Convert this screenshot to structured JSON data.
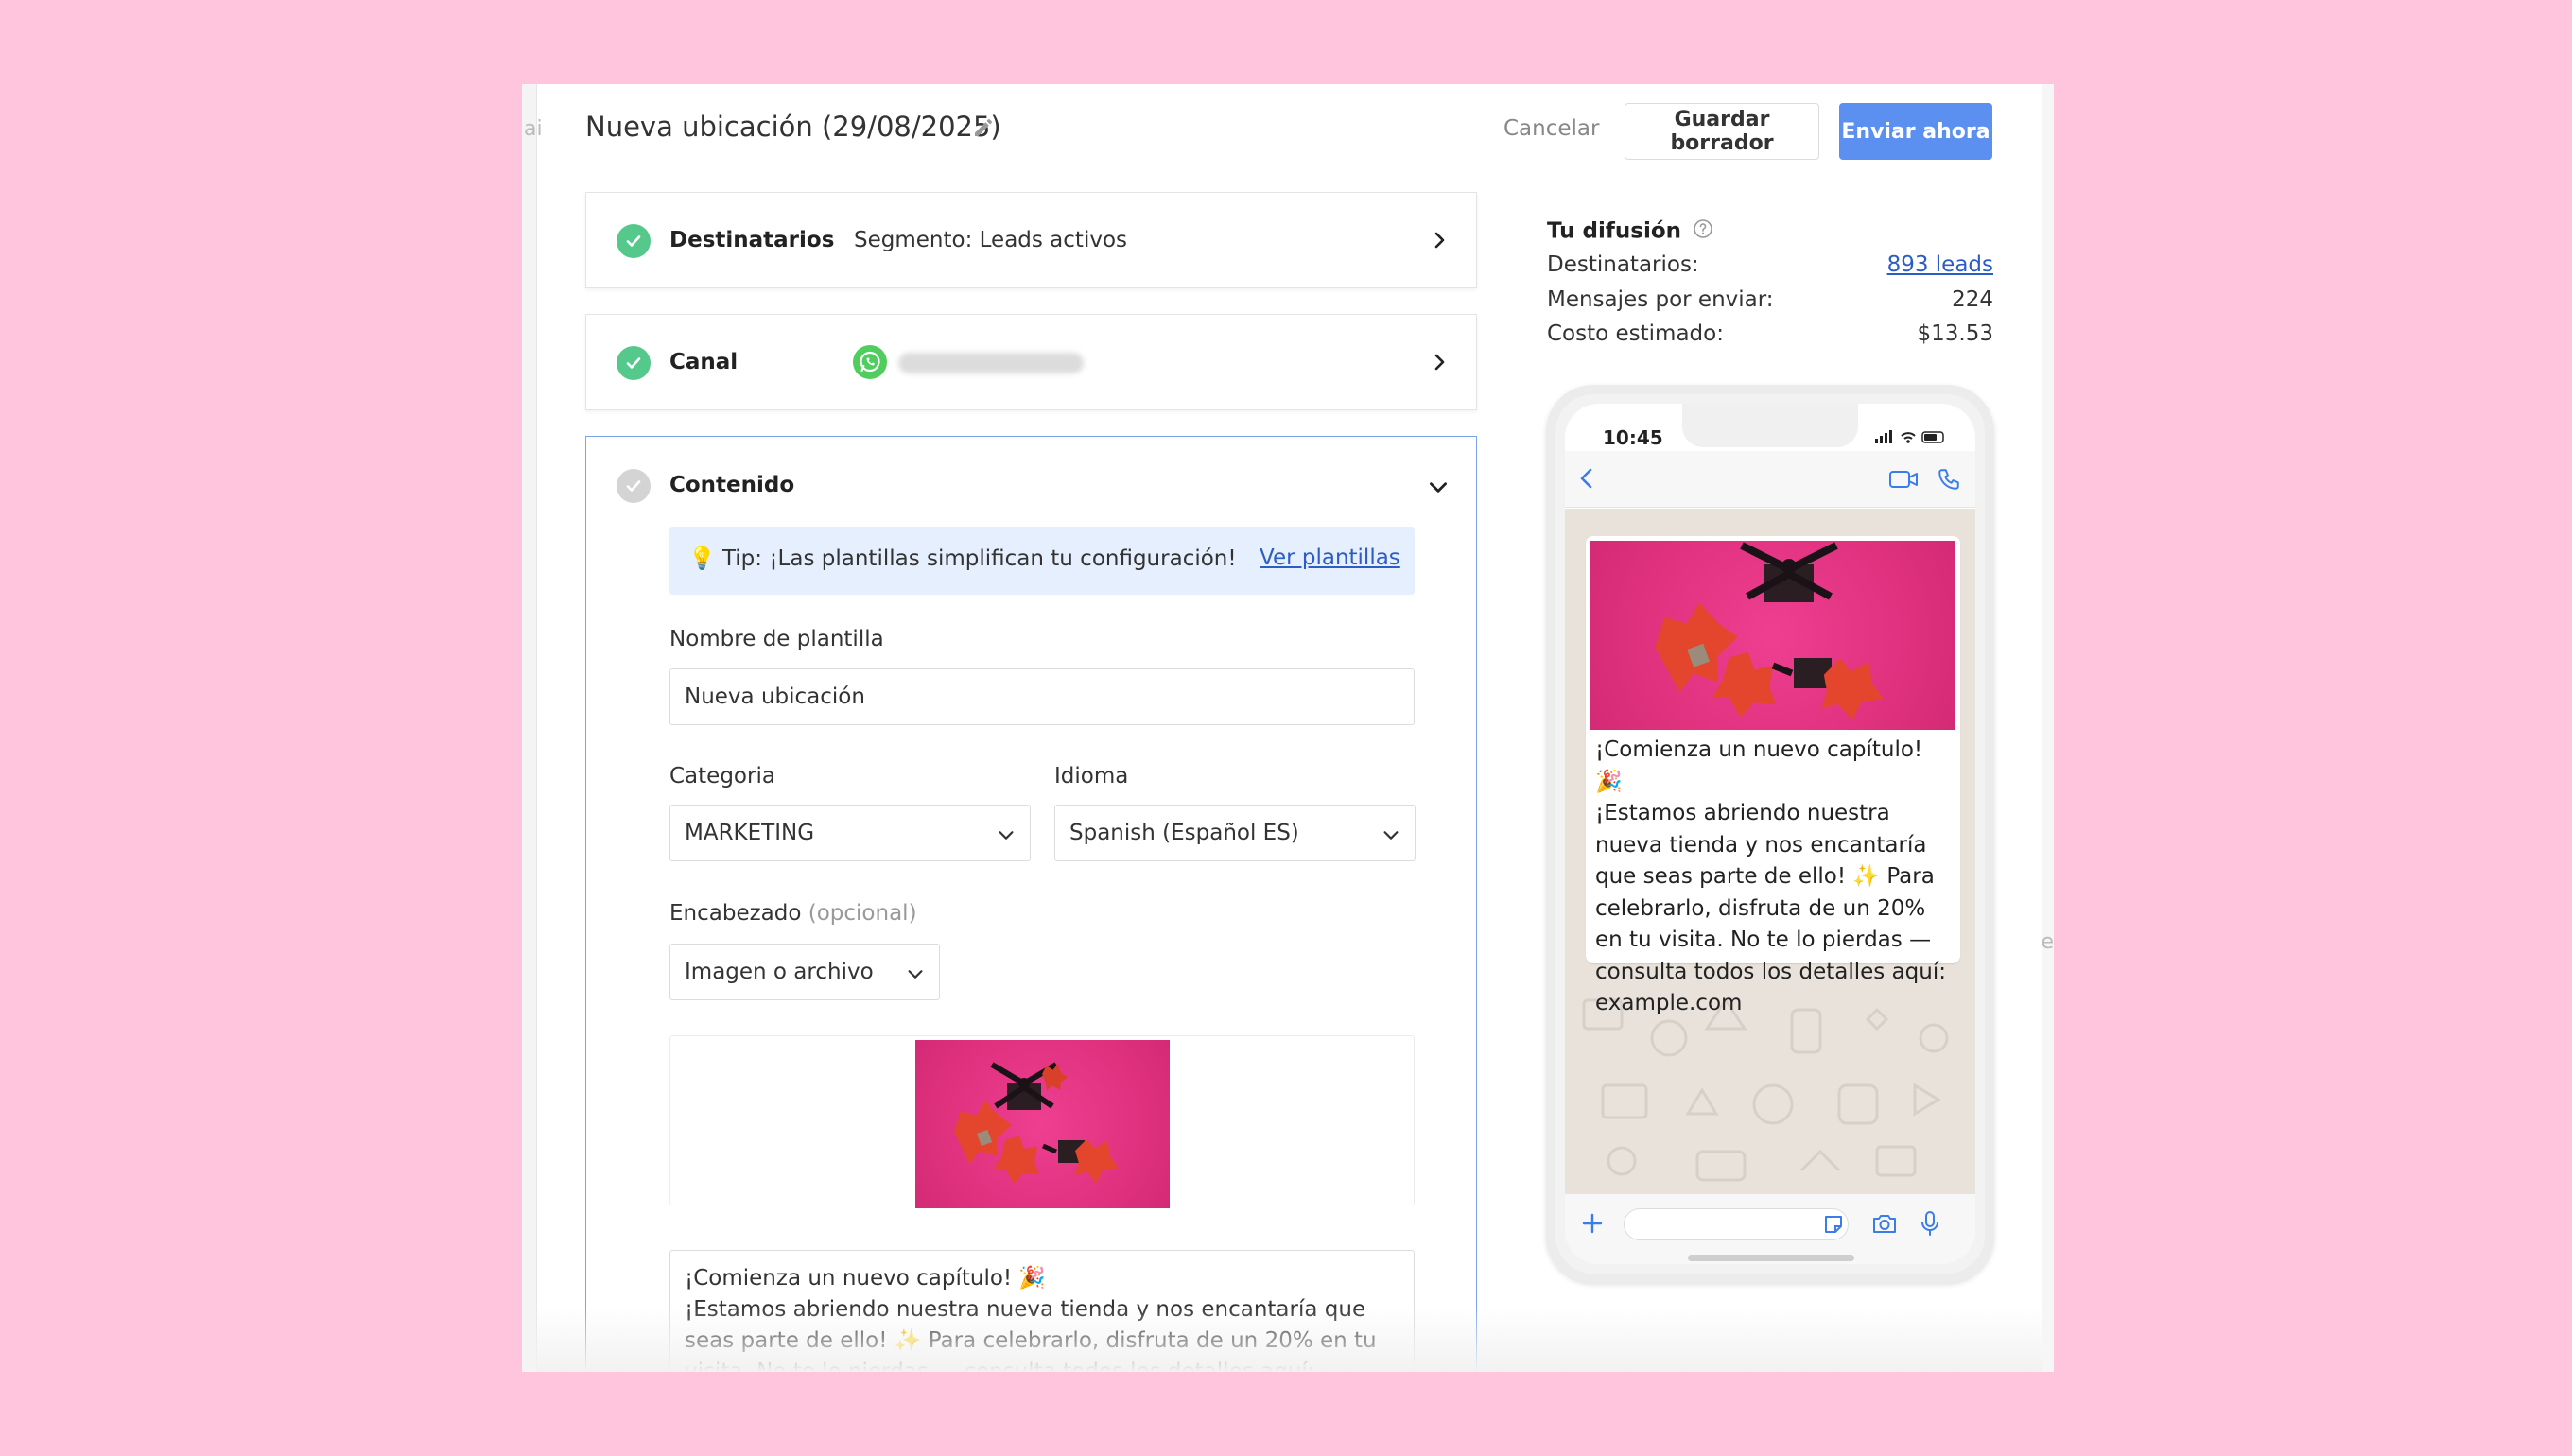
{
  "header": {
    "title": "Nueva ubicación (29/08/2025)",
    "cancel_label": "Cancelar",
    "draft_label": "Guardar borrador",
    "send_label": "Enviar ahora"
  },
  "steps": {
    "recipients": {
      "title": "Destinatarios",
      "value": "Segmento: Leads activos"
    },
    "channel": {
      "title": "Canal"
    },
    "content": {
      "title": "Contenido"
    }
  },
  "content": {
    "tip_text": "💡 Tip: ¡Las plantillas simplifican tu configuración!",
    "tip_link": "Ver plantillas",
    "template_name_label": "Nombre de plantilla",
    "template_name_value": "Nueva ubicación",
    "category_label": "Categoria",
    "category_value": "MARKETING",
    "language_label": "Idioma",
    "language_value": "Spanish (Español ES)",
    "header_label": "Encabezado",
    "header_optional": "(opcional)",
    "header_type_value": "Imagen o archivo",
    "body_text": "¡Comienza un nuevo capítulo! 🎉\n¡Estamos abriendo nuestra nueva tienda y nos encantaría que seas parte de ello! ✨ Para celebrarlo, disfruta de un 20% en tu visita. No te lo pierdas — consulta todos los detalles aquí: example.com"
  },
  "summary": {
    "title": "Tu difusión",
    "recipients_label": "Destinatarios:",
    "recipients_value": "893 leads",
    "messages_label": "Mensajes por enviar:",
    "messages_value": "224",
    "cost_label": "Costo estimado:",
    "cost_value": "$13.53"
  },
  "phone": {
    "time": "10:45",
    "message": "¡Comienza un nuevo capítulo! 🎉\n¡Estamos abriendo nuestra nueva tienda y nos encantaría que seas parte de ello! ✨ Para celebrarlo, disfruta de un 20% en tu visita. No te lo pierdas — consulta todos los detalles aquí: example.com"
  },
  "colors": {
    "background": "#fec5dc",
    "primary": "#5b8ff0",
    "success": "#55c98b",
    "whatsapp": "#4fce5d",
    "link": "#2c5cc5",
    "tip_bg": "#e6effd",
    "image_bg": "#e0327f"
  }
}
